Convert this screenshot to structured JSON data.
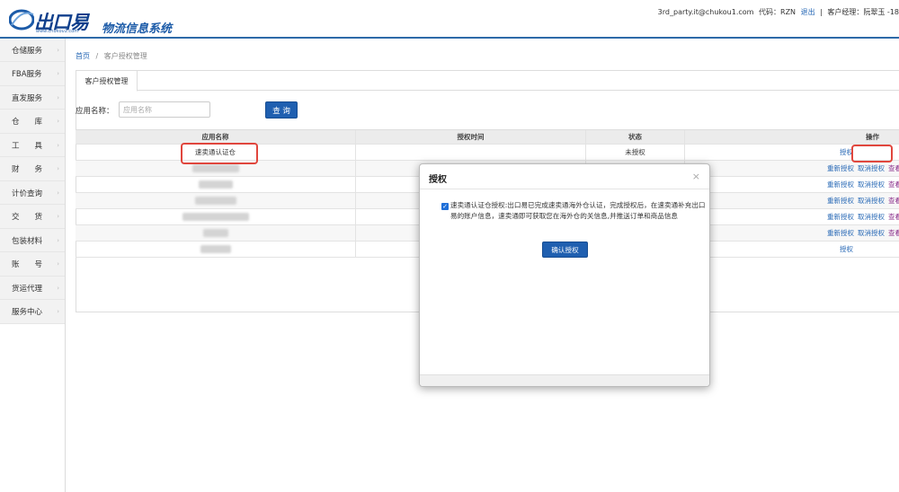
{
  "header": {
    "logo_text": "出口易",
    "logo_url": "www.chukou1.com",
    "system_name": "物流信息系统",
    "user_email": "3rd_party.it@chukou1.com",
    "code_label": "代码：",
    "code_value": "RZN",
    "logout": "退出",
    "separator": "|",
    "manager_label": "客户经理：",
    "manager_value": "阮翠玉 -18"
  },
  "sidebar": {
    "items": [
      {
        "label": "仓储服务"
      },
      {
        "label": "FBA服务"
      },
      {
        "label": "直发服务"
      },
      {
        "label": "仓　　库"
      },
      {
        "label": "工　　具"
      },
      {
        "label": "财　　务"
      },
      {
        "label": "计价查询"
      },
      {
        "label": "交　　货"
      },
      {
        "label": "包装材料"
      },
      {
        "label": "账　　号"
      },
      {
        "label": "货运代理"
      },
      {
        "label": "服务中心"
      }
    ],
    "arrow": "›"
  },
  "breadcrumb": {
    "home": "首页",
    "sep": "/",
    "current": "客户授权管理"
  },
  "tab": {
    "label": "客户授权管理"
  },
  "search": {
    "label": "应用名称：",
    "placeholder": "应用名称",
    "button": "查 询"
  },
  "table": {
    "headers": [
      "应用名称",
      "授权时间",
      "状态",
      "操作"
    ],
    "first_row": {
      "app_name": "速卖通认证仓",
      "auth_time": "",
      "status": "未授权",
      "action": "授权"
    },
    "ops": {
      "reauth": "重新授权",
      "cancel": "取消授权",
      "view": "查看"
    },
    "last_row_action": "授权"
  },
  "modal": {
    "title": "授权",
    "close": "×",
    "checkbox_mark": "✓",
    "text": "速卖通认证仓授权:出口易已完成速卖通海外仓认证，完成授权后，在速卖通补充出口易的账户信息，速卖通即可获取您在海外仓的关信息,并推送订单和商品信息",
    "confirm": "确认授权"
  },
  "colors": {
    "primary": "#1f5fb0",
    "link": "#2869b6",
    "highlight": "#e0463d"
  }
}
